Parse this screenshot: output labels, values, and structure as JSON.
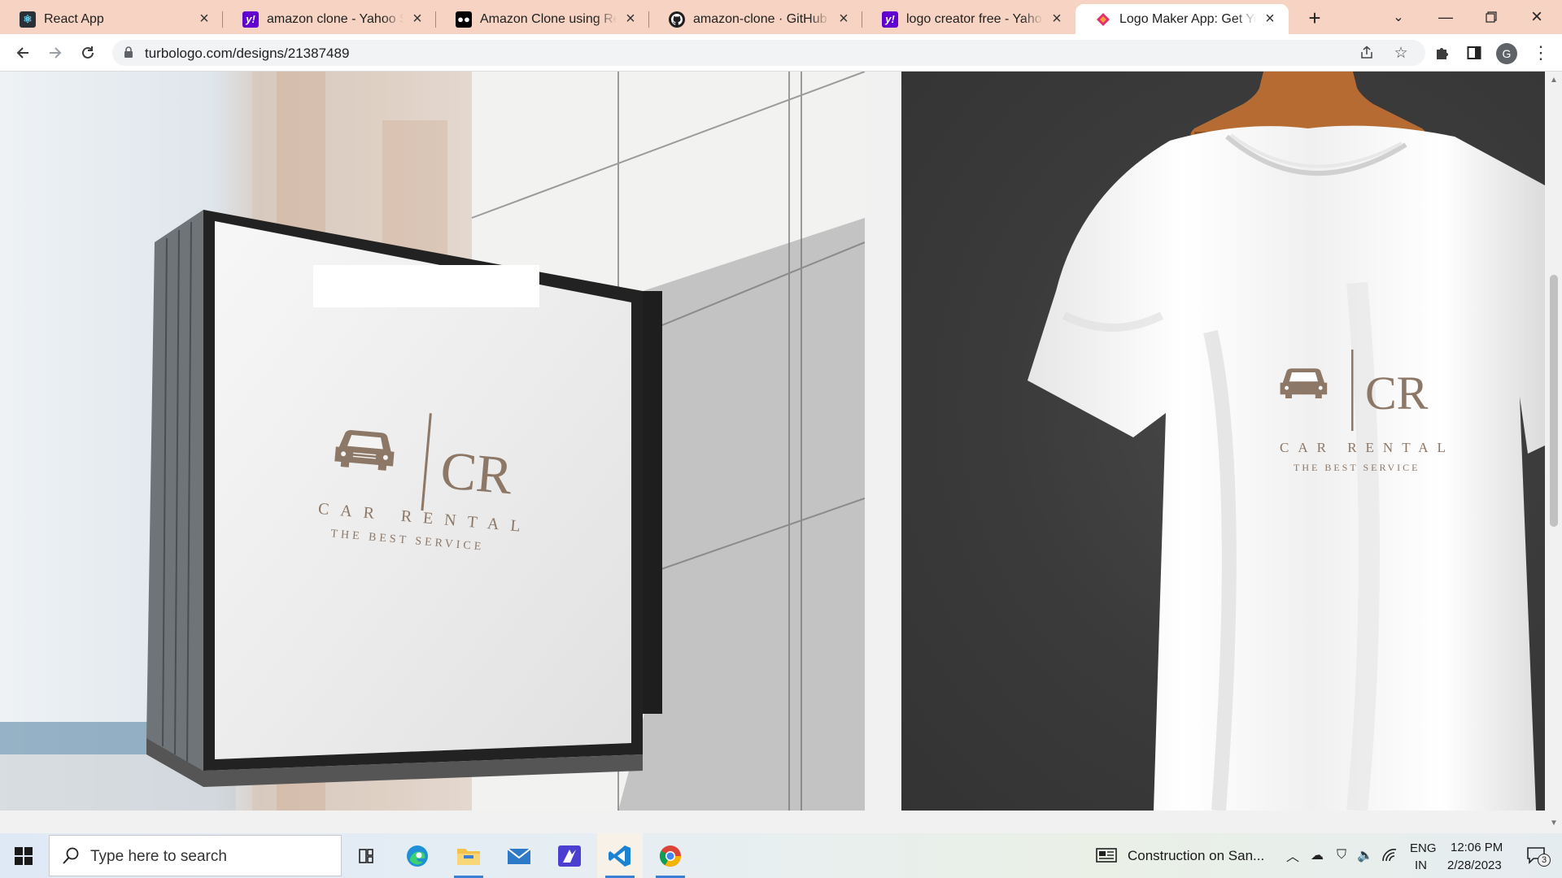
{
  "browser": {
    "tabs": [
      {
        "title": "React App",
        "favicon": "react-icon"
      },
      {
        "title": "amazon clone - Yahoo Search Results",
        "favicon": "yahoo-icon"
      },
      {
        "title": "Amazon Clone using ReactJS",
        "favicon": "medium-icon"
      },
      {
        "title": "amazon-clone · GitHub Topics",
        "favicon": "github-icon"
      },
      {
        "title": "logo creator free - Yahoo Search Results",
        "favicon": "yahoo-icon"
      },
      {
        "title": "Logo Maker App: Get Your Logo",
        "favicon": "turbologo-icon",
        "active": true
      }
    ],
    "address": "turbologo.com/designs/21387489",
    "profile_initial": "G"
  },
  "logo": {
    "monogram": "CR",
    "name": "CAR RENTAL",
    "tagline": "THE BEST SERVICE",
    "color": "#8d7766",
    "car_icon": "car-icon"
  },
  "taskbar": {
    "search_placeholder": "Type here to search",
    "news": "Construction on San...",
    "lang_top": "ENG",
    "lang_bottom": "IN",
    "time": "12:06 PM",
    "date": "2/28/2023",
    "notifications": "3"
  },
  "colors": {
    "tabstrip": "#f6d3c2",
    "accent": "#3b7fd6"
  }
}
